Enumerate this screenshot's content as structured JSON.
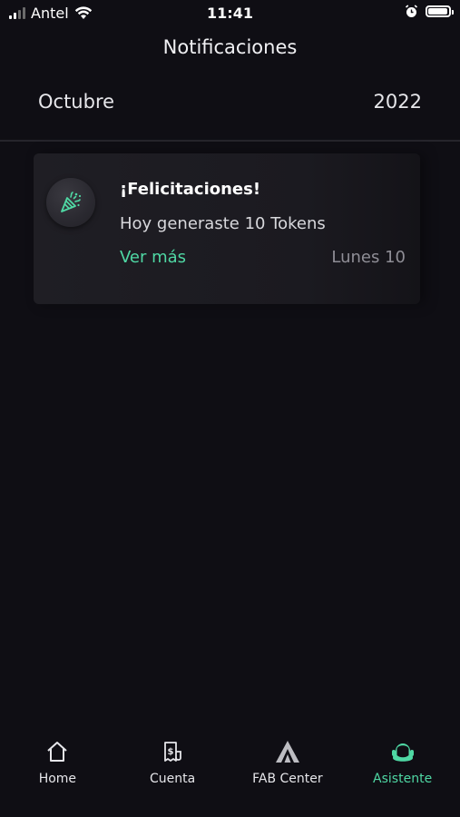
{
  "status_bar": {
    "carrier": "Antel",
    "time": "11:41"
  },
  "header": {
    "title": "Notificaciones"
  },
  "month_header": {
    "month": "Octubre",
    "year": "2022"
  },
  "notifications": [
    {
      "icon": "party-popper-icon",
      "title": "¡Felicitaciones!",
      "body": "Hoy generaste 10 Tokens",
      "link_label": "Ver más",
      "date": "Lunes 10"
    }
  ],
  "bottom_nav": {
    "items": [
      {
        "label": "Home",
        "icon": "home-icon",
        "active": false
      },
      {
        "label": "Cuenta",
        "icon": "receipt-icon",
        "active": false
      },
      {
        "label": "FAB Center",
        "icon": "triangle-logo-icon",
        "active": false
      },
      {
        "label": "Asistente",
        "icon": "assistant-avatar-icon",
        "active": true
      }
    ]
  },
  "colors": {
    "background": "#0f0e14",
    "card": "#1f1e24",
    "accent": "#4fd8a4",
    "muted_text": "#8f8e96"
  }
}
